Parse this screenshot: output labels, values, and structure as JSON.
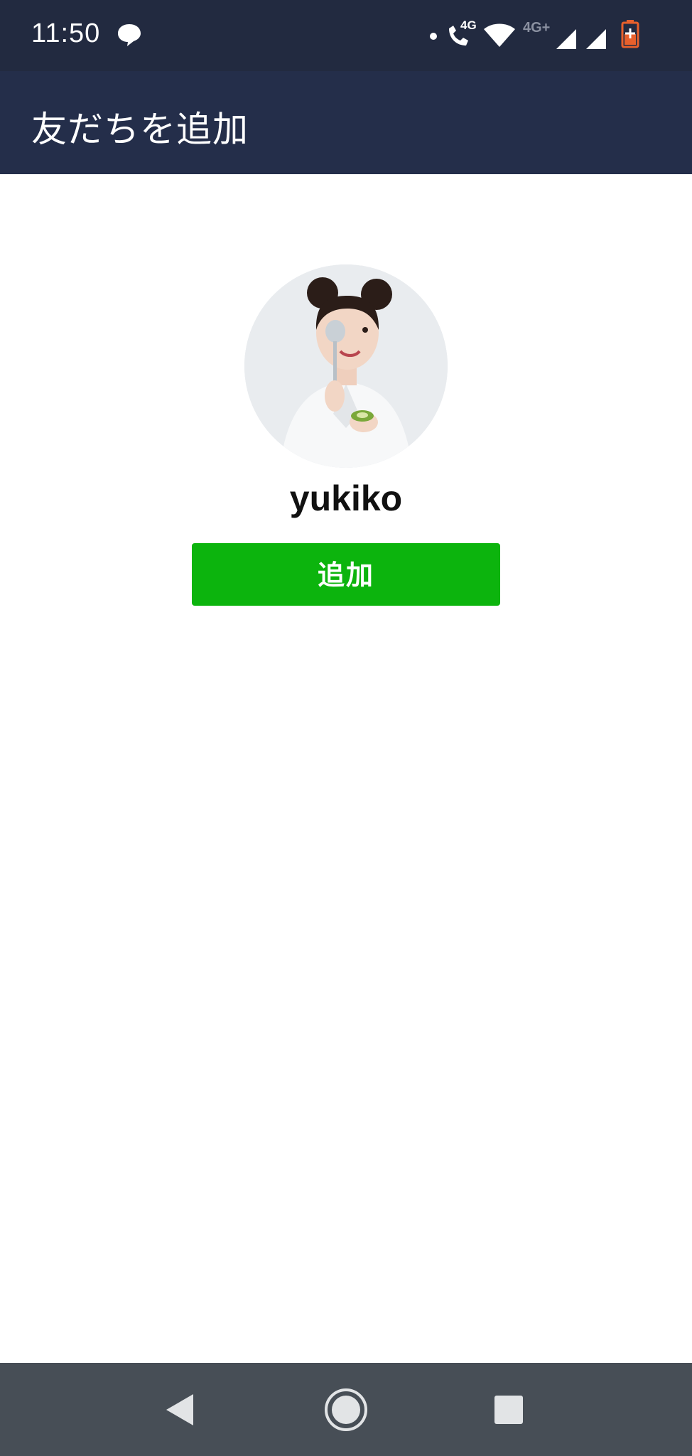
{
  "status_bar": {
    "time": "11:50",
    "network_label": "4G",
    "network_label_2": "4G+",
    "icons": [
      "chat-bubble-icon",
      "dot-icon",
      "volte-call-icon",
      "wifi-icon",
      "signal-icon",
      "signal-icon",
      "battery-charging-icon"
    ]
  },
  "header": {
    "title": "友だちを追加"
  },
  "profile": {
    "name": "yukiko",
    "photo_description": "avatar"
  },
  "actions": {
    "add_label": "追加"
  },
  "nav": {
    "icons": [
      "back-icon",
      "home-icon",
      "recents-icon"
    ]
  },
  "colors": {
    "status_bar": "#222a40",
    "header": "#242e4a",
    "add_button": "#0cb40d",
    "nav_bar": "#474e56",
    "battery": "#e8602c"
  }
}
